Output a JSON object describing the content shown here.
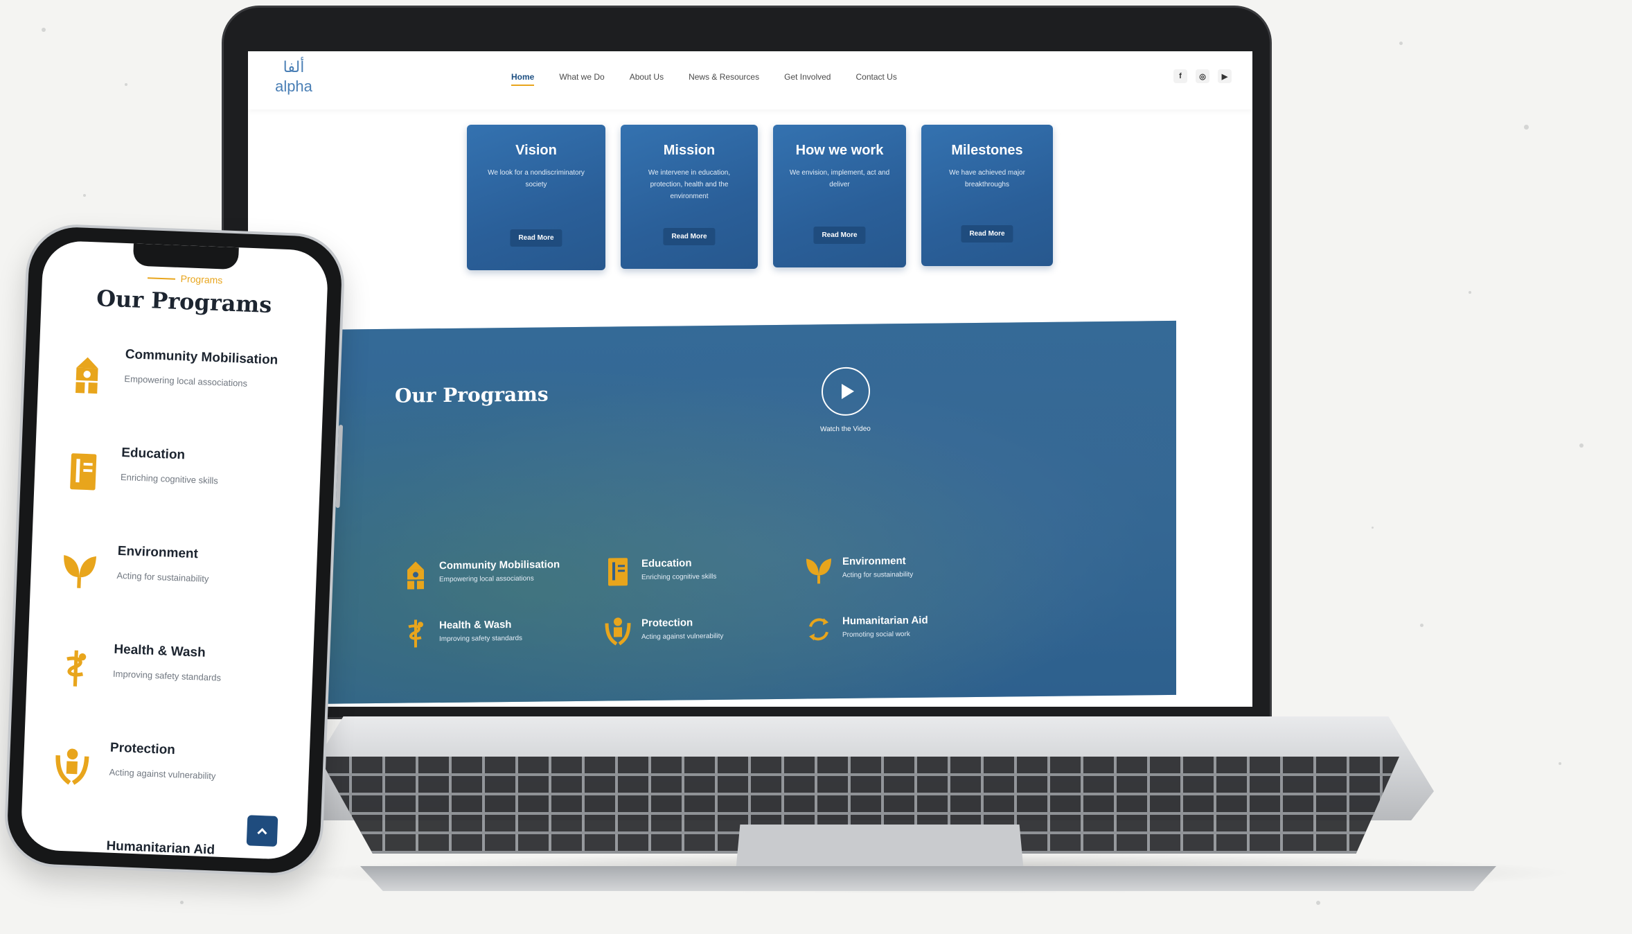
{
  "site": {
    "logo": {
      "arabic": "ألفا",
      "latin": "alpha"
    },
    "nav": [
      {
        "label": "Home",
        "active": true
      },
      {
        "label": "What we Do",
        "active": false
      },
      {
        "label": "About Us",
        "active": false
      },
      {
        "label": "News & Resources",
        "active": false
      },
      {
        "label": "Get Involved",
        "active": false
      },
      {
        "label": "Contact Us",
        "active": false
      }
    ],
    "socials": [
      {
        "icon": "facebook-icon",
        "glyph": "f"
      },
      {
        "icon": "instagram-icon",
        "glyph": "◎"
      },
      {
        "icon": "youtube-icon",
        "glyph": "▶"
      }
    ],
    "cards": [
      {
        "title": "Vision",
        "desc": "We look for a nondiscriminatory society",
        "button": "Read More"
      },
      {
        "title": "Mission",
        "desc": "We intervene in education, protection, health and the environment",
        "button": "Read More"
      },
      {
        "title": "How we work",
        "desc": "We envision, implement, act and deliver",
        "button": "Read More"
      },
      {
        "title": "Milestones",
        "desc": "We have achieved major breakthroughs",
        "button": "Read More"
      }
    ],
    "programs": {
      "title": "Our Programs",
      "video_label": "Watch the Video",
      "items": [
        {
          "name": "Community Mobilisation",
          "desc": "Empowering local associations",
          "icon": "community-icon"
        },
        {
          "name": "Education",
          "desc": "Enriching cognitive skills",
          "icon": "book-icon"
        },
        {
          "name": "Environment",
          "desc": "Acting for sustainability",
          "icon": "leaf-icon"
        },
        {
          "name": "Health & Wash",
          "desc": "Improving safety standards",
          "icon": "health-icon"
        },
        {
          "name": "Protection",
          "desc": "Acting against vulnerability",
          "icon": "protection-icon"
        },
        {
          "name": "Humanitarian Aid",
          "desc": "Promoting social work",
          "icon": "recycle-icon"
        }
      ]
    }
  },
  "phone": {
    "eyebrow": "Programs",
    "title": "Our Programs",
    "items": [
      {
        "name": "Community Mobilisation",
        "desc": "Empowering local associations"
      },
      {
        "name": "Education",
        "desc": "Enriching cognitive skills"
      },
      {
        "name": "Environment",
        "desc": "Acting for sustainability"
      },
      {
        "name": "Health & Wash",
        "desc": "Improving safety standards"
      },
      {
        "name": "Protection",
        "desc": "Acting against vulnerability"
      },
      {
        "name": "Humanitarian Aid",
        "desc": ""
      }
    ]
  },
  "colors": {
    "accent": "#e8a51c",
    "primary": "#2a5f99",
    "dark_blue": "#1f4c7e"
  }
}
